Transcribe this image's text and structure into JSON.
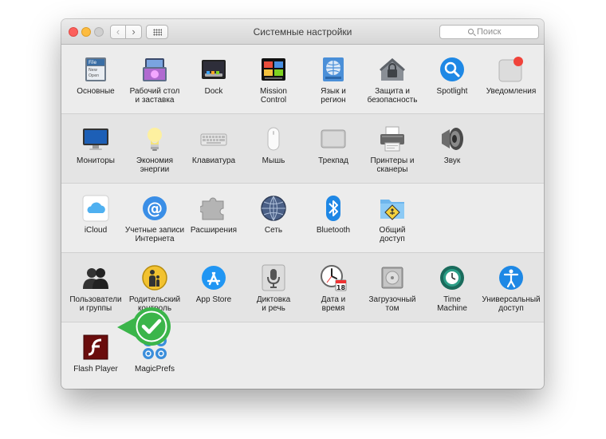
{
  "window": {
    "title": "Системные настройки",
    "search_placeholder": "Поиск",
    "back_glyph": "‹",
    "forward_glyph": "›"
  },
  "rows": [
    [
      {
        "label": "Основные",
        "icon": "general-icon"
      },
      {
        "label": "Рабочий стол\nи заставка",
        "icon": "desktop-screensaver-icon"
      },
      {
        "label": "Dock",
        "icon": "dock-icon"
      },
      {
        "label": "Mission\nControl",
        "icon": "mission-control-icon"
      },
      {
        "label": "Язык и\nрегион",
        "icon": "language-region-icon"
      },
      {
        "label": "Защита и\nбезопасность",
        "icon": "security-icon"
      },
      {
        "label": "Spotlight",
        "icon": "spotlight-icon"
      },
      {
        "label": "Уведомления",
        "icon": "notifications-icon"
      }
    ],
    [
      {
        "label": "Мониторы",
        "icon": "displays-icon"
      },
      {
        "label": "Экономия\nэнергии",
        "icon": "energy-saver-icon"
      },
      {
        "label": "Клавиатура",
        "icon": "keyboard-icon"
      },
      {
        "label": "Мышь",
        "icon": "mouse-icon"
      },
      {
        "label": "Трекпад",
        "icon": "trackpad-icon"
      },
      {
        "label": "Принтеры и\nсканеры",
        "icon": "printers-icon"
      },
      {
        "label": "Звук",
        "icon": "sound-icon"
      }
    ],
    [
      {
        "label": "iCloud",
        "icon": "icloud-icon"
      },
      {
        "label": "Учетные записи\nИнтернета",
        "icon": "internet-accounts-icon"
      },
      {
        "label": "Расширения",
        "icon": "extensions-icon"
      },
      {
        "label": "Сеть",
        "icon": "network-icon"
      },
      {
        "label": "Bluetooth",
        "icon": "bluetooth-icon"
      },
      {
        "label": "Общий\nдоступ",
        "icon": "sharing-icon"
      }
    ],
    [
      {
        "label": "Пользователи\nи группы",
        "icon": "users-groups-icon"
      },
      {
        "label": "Родительский\nконтроль",
        "icon": "parental-controls-icon"
      },
      {
        "label": "App Store",
        "icon": "app-store-icon"
      },
      {
        "label": "Диктовка\nи речь",
        "icon": "dictation-icon"
      },
      {
        "label": "Дата и\nвремя",
        "icon": "date-time-icon"
      },
      {
        "label": "Загрузочный\nтом",
        "icon": "startup-disk-icon"
      },
      {
        "label": "Time\nMachine",
        "icon": "time-machine-icon"
      },
      {
        "label": "Универсальный\nдоступ",
        "icon": "accessibility-icon"
      }
    ],
    [
      {
        "label": "Flash Player",
        "icon": "flash-player-icon"
      },
      {
        "label": "MagicPrefs",
        "icon": "magicprefs-icon"
      }
    ]
  ],
  "icon_glyphs": {
    "general_file_text": "File\nNew\nOpen",
    "date_calendar_day": "18"
  },
  "highlight": {
    "icon": "checkmark-icon",
    "color": "#3bb54a"
  }
}
